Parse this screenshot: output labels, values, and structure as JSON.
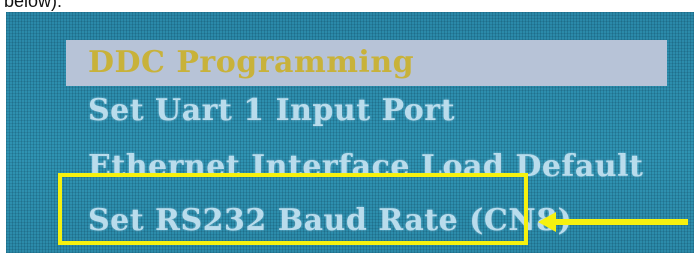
{
  "caption": "below):",
  "menu": {
    "items": [
      {
        "label": "DDC Programming"
      },
      {
        "label": "Set Uart 1 Input Port"
      },
      {
        "label": "Ethernet Interface Load Default"
      },
      {
        "label": "Set RS232 Baud Rate (CN8)"
      }
    ]
  },
  "colors": {
    "screen_bg": "#2e8fae",
    "selected_bg": "#b7c3d7",
    "selected_text": "#c8b23a",
    "item_text": "#b9dcec",
    "annotation": "#f6f10f"
  },
  "icons": {
    "annotation_arrow": "arrow-left-icon"
  }
}
